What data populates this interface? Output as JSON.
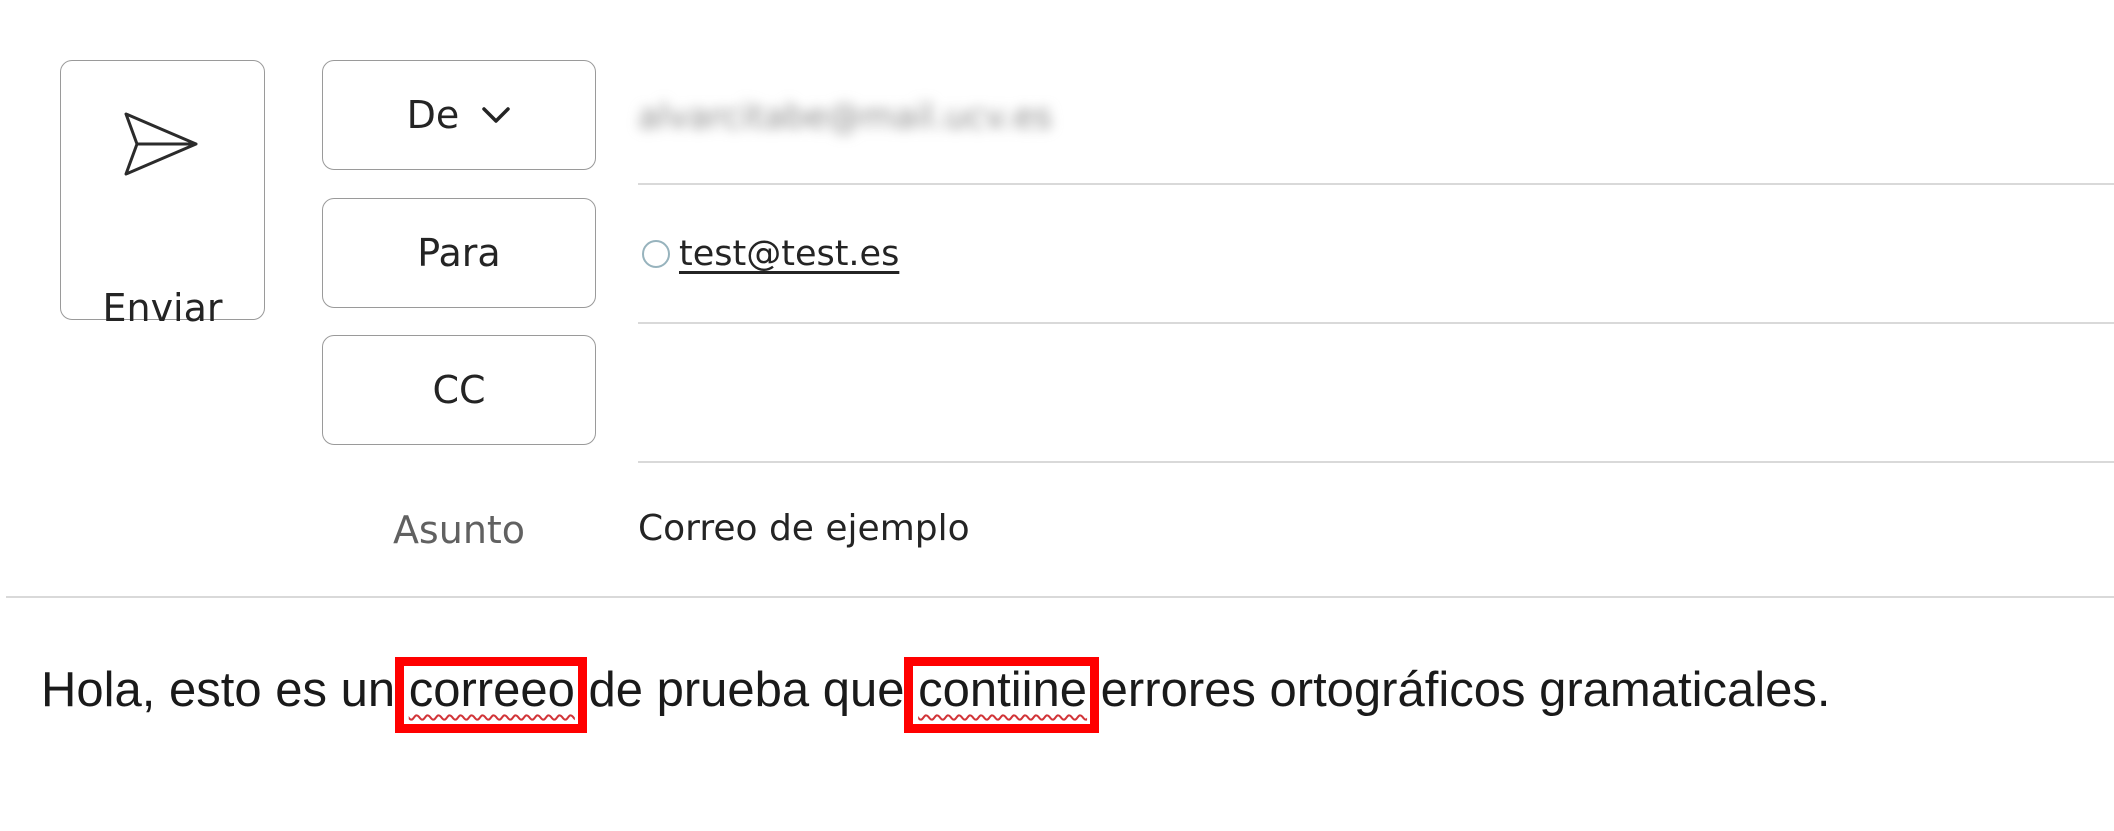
{
  "send": {
    "label": "Enviar",
    "icon": "send-icon"
  },
  "from": {
    "label": "De",
    "icon": "chevron-down-icon",
    "value": "alvarcitabe@mail.ucv.es"
  },
  "to": {
    "label": "Para",
    "recipients": [
      {
        "email": "test@test.es"
      }
    ]
  },
  "cc": {
    "label": "CC"
  },
  "subject": {
    "label": "Asunto",
    "value": "Correo de ejemplo"
  },
  "body": {
    "part1": "Hola, esto es un ",
    "misspelled1": "correeo",
    "part2": " de prueba que ",
    "misspelled2": "contiine",
    "part3": " errores ortográficos gramaticales."
  },
  "colors": {
    "highlight_box": "#ff0000",
    "spellcheck_underline": "#d13438",
    "recipient_circle": "#97b3bd"
  }
}
